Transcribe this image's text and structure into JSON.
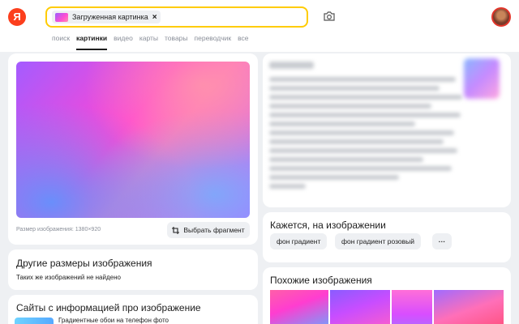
{
  "header": {
    "logo_letter": "Я",
    "search": {
      "chip_label": "Загруженная картинка",
      "chip_close": "×"
    },
    "camera_icon": "camera-icon"
  },
  "tabs": [
    {
      "label": "поиск",
      "active": false
    },
    {
      "label": "картинки",
      "active": true
    },
    {
      "label": "видео",
      "active": false
    },
    {
      "label": "карты",
      "active": false
    },
    {
      "label": "товары",
      "active": false
    },
    {
      "label": "переводчик",
      "active": false
    },
    {
      "label": "все",
      "active": false
    }
  ],
  "image_card": {
    "size_text": "Размер изображения: 1380×920",
    "fragment_button": "Выбрать фрагмент"
  },
  "sizes_card": {
    "title": "Другие размеры изображения",
    "subtitle": "Таких же изображений не найдено"
  },
  "sites_card": {
    "title": "Сайты с информацией про изображение",
    "first_item": "Градиентные обои на телефон фото"
  },
  "tags_card": {
    "title": "Кажется, на изображении",
    "tags": [
      "фон градиент",
      "фон градиент розовый"
    ],
    "more": "···"
  },
  "similar_card": {
    "title": "Похожие изображения"
  },
  "colors": {
    "accent_yellow": "#ffcc00",
    "logo_red": "#fc3f1d",
    "page_bg": "#eef0f3"
  }
}
